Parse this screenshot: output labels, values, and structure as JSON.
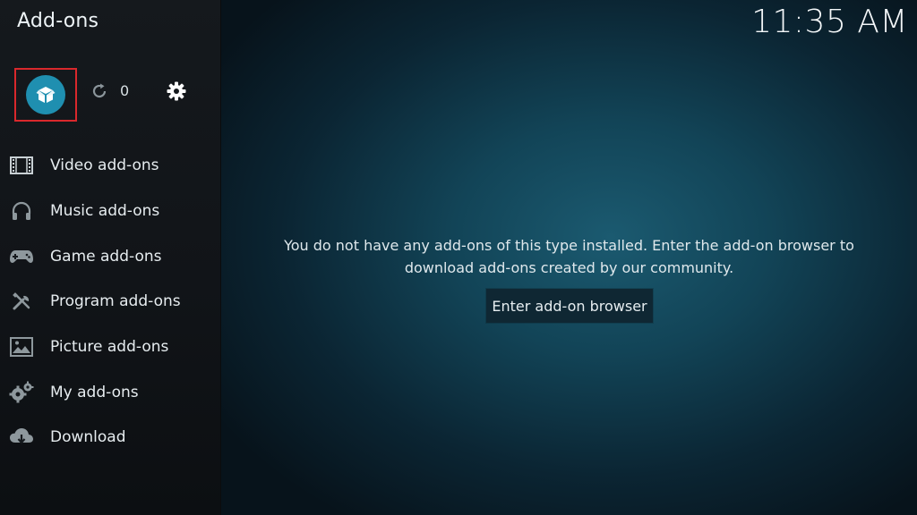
{
  "header": {
    "title": "Add-ons",
    "clock": "11:35 AM"
  },
  "toolbar": {
    "addon_browser_icon": "open-box-icon",
    "refresh_icon": "refresh-icon",
    "updates_count": "0",
    "settings_icon": "gear-icon",
    "highlight_color": "#d9282c",
    "accent_color": "#1f8fb0"
  },
  "sidebar": {
    "items": [
      {
        "label": "Video add-ons",
        "icon": "film-icon"
      },
      {
        "label": "Music add-ons",
        "icon": "headphones-icon"
      },
      {
        "label": "Game add-ons",
        "icon": "gamepad-icon"
      },
      {
        "label": "Program add-ons",
        "icon": "tools-icon"
      },
      {
        "label": "Picture add-ons",
        "icon": "picture-icon"
      },
      {
        "label": "My add-ons",
        "icon": "gears-icon"
      },
      {
        "label": "Download",
        "icon": "cloud-download-icon"
      }
    ]
  },
  "main": {
    "message_line1": "You do not have any add-ons of this type installed. Enter the add-on browser to",
    "message_line2": "download add-ons created by our community.",
    "button_label": "Enter add-on browser"
  }
}
